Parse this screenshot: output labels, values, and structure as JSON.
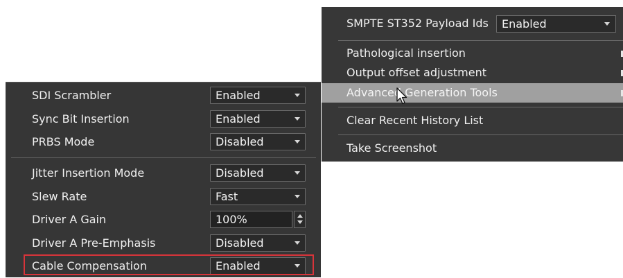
{
  "settings_panel": {
    "rows": [
      {
        "label": "SDI Scrambler",
        "value": "Enabled"
      },
      {
        "label": "Sync Bit Insertion",
        "value": "Enabled"
      },
      {
        "label": "PRBS Mode",
        "value": "Disabled"
      },
      {
        "label": "Jitter Insertion Mode",
        "value": "Disabled"
      },
      {
        "label": "Slew Rate",
        "value": "Fast"
      },
      {
        "label": "Driver A Gain",
        "value": "100%"
      },
      {
        "label": "Driver A Pre-Emphasis",
        "value": "Disabled"
      },
      {
        "label": "Cable Compensation",
        "value": "Enabled"
      }
    ],
    "highlight_color": "#d9343a"
  },
  "context_menu": {
    "payload_row": {
      "label": "SMPTE ST352 Payload Ids",
      "value": "Enabled"
    },
    "items": [
      {
        "label": "Pathological insertion"
      },
      {
        "label": "Output offset adjustment"
      },
      {
        "label": "Advanced Generation Tools"
      },
      {
        "label": "Clear Recent History List"
      },
      {
        "label": "Take Screenshot"
      }
    ],
    "hover_color": "#a0a0a0"
  }
}
